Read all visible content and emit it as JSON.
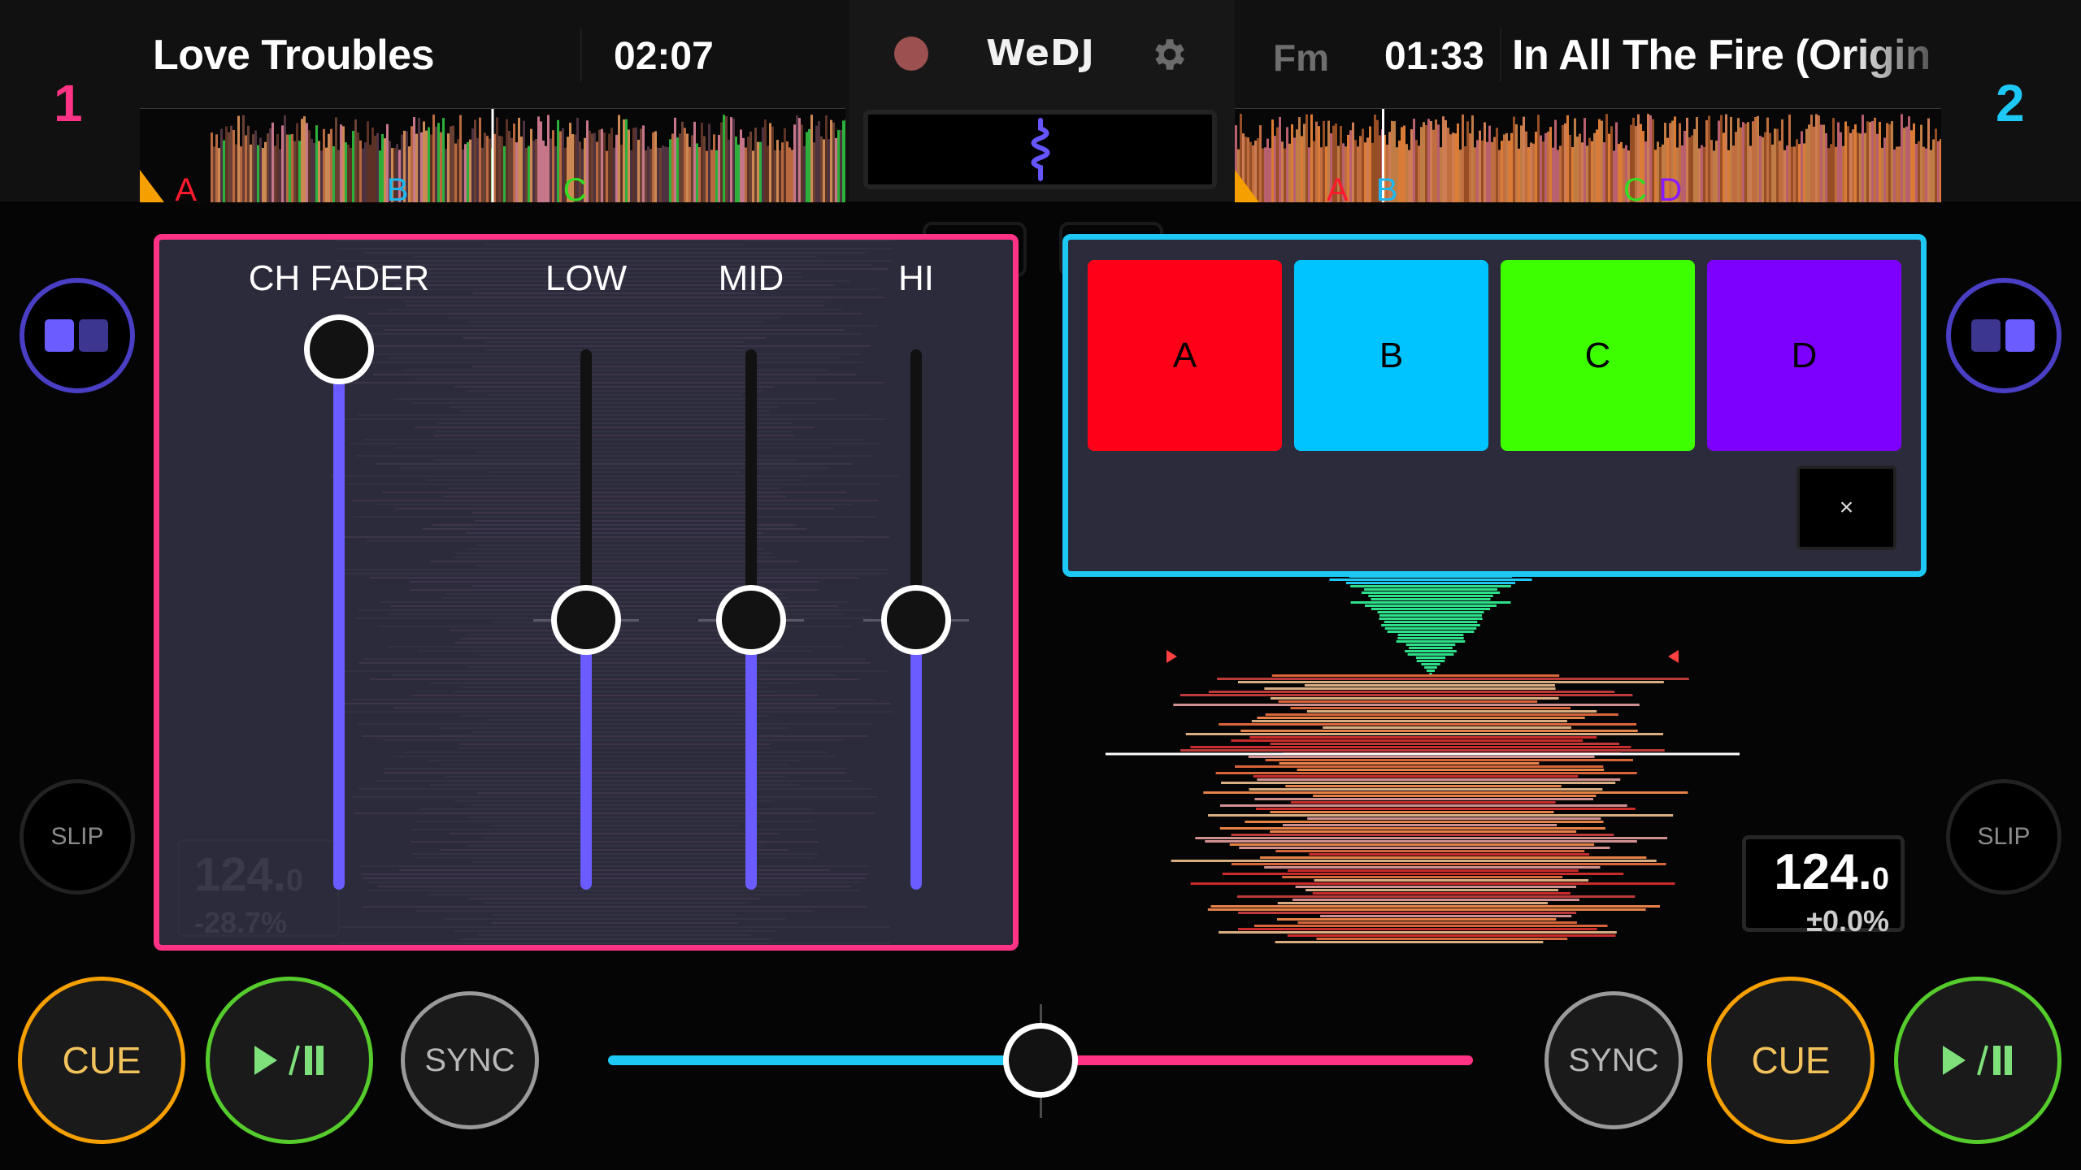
{
  "app": {
    "brand": "WeDJ"
  },
  "colors": {
    "deck1": "#ff3385",
    "deck2": "#1ec8f5",
    "fader_fill": "#6a5cff",
    "cue": "#f5a000",
    "play": "#55cc2b",
    "sync": "#9a9a9a",
    "record_dot": "#9c5050"
  },
  "deck1": {
    "number": "1",
    "title": "Love Troubles",
    "time": "02:07",
    "bpm_main": "124.",
    "bpm_decimal": "0",
    "pitch": "-28.7%",
    "playhead_position": 0.5,
    "hot_cue_markers": [
      {
        "label": "A",
        "position": 0.05,
        "color": "#ff1a2e"
      },
      {
        "label": "B",
        "position": 0.35,
        "color": "#1eb8f0"
      },
      {
        "label": "C",
        "position": 0.6,
        "color": "#33dd22"
      }
    ],
    "slip_label": "SLIP",
    "cue_label": "CUE",
    "play_label": "▶/❚❚",
    "sync_label": "SYNC"
  },
  "deck2": {
    "number": "2",
    "title": "In All The Fire (Origin",
    "time": "01:33",
    "key": "Fm",
    "bpm_main": "124.",
    "bpm_decimal": "0",
    "pitch": "±0.0%",
    "playhead_position": 0.21,
    "hot_cue_markers": [
      {
        "label": "A",
        "position": 0.13,
        "color": "#ff1a2e"
      },
      {
        "label": "B",
        "position": 0.2,
        "color": "#1eb8f0"
      },
      {
        "label": "C",
        "position": 0.55,
        "color": "#33dd22"
      },
      {
        "label": "D",
        "position": 0.6,
        "color": "#8a1aff"
      }
    ],
    "slip_label": "SLIP",
    "cue_label": "CUE",
    "play_label": "▶/❚❚",
    "sync_label": "SYNC"
  },
  "mixer": {
    "channels": [
      {
        "label": "CH FADER",
        "value": 1.0
      },
      {
        "label": "LOW",
        "value": 0.5
      },
      {
        "label": "MID",
        "value": 0.5
      },
      {
        "label": "HI",
        "value": 0.5
      }
    ]
  },
  "hot_cues": {
    "pads": [
      {
        "label": "A",
        "color": "#ff0019"
      },
      {
        "label": "B",
        "color": "#00c4ff"
      },
      {
        "label": "C",
        "color": "#3dff00"
      },
      {
        "label": "D",
        "color": "#7d00ff"
      }
    ],
    "close_label": "×"
  },
  "crossfader": {
    "value": 0.5
  }
}
